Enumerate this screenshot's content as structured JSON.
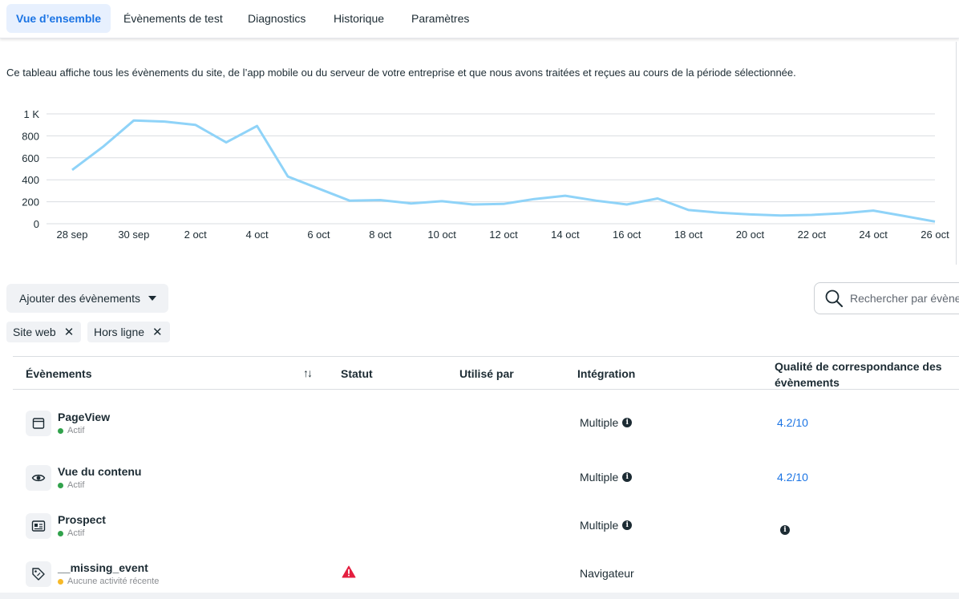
{
  "tabs": [
    {
      "label": "Vue d’ensemble",
      "active": true
    },
    {
      "label": "Évènements de test"
    },
    {
      "label": "Diagnostics"
    },
    {
      "label": "Historique"
    },
    {
      "label": "Paramètres"
    }
  ],
  "description": "Ce tableau affiche tous les évènements du site, de l’app mobile ou du serveur de votre entreprise et que nous avons traitées et reçues au cours de la période sélectionnée.",
  "chart_data": {
    "type": "line",
    "y_tick_labels": [
      "0",
      "200",
      "400",
      "600",
      "800",
      "1 K"
    ],
    "y_ticks": [
      0,
      200,
      400,
      600,
      800,
      1000
    ],
    "ylim": [
      0,
      1000
    ],
    "x_tick_labels": [
      "28 sep",
      "30 sep",
      "2 oct",
      "4 oct",
      "6 oct",
      "8 oct",
      "10 oct",
      "12 oct",
      "14 oct",
      "16 oct",
      "18 oct",
      "20 oct",
      "22 oct",
      "24 oct",
      "26 oct"
    ],
    "x": [
      "28 sep",
      "29 sep",
      "30 sep",
      "1 oct",
      "2 oct",
      "3 oct",
      "4 oct",
      "5 oct",
      "6 oct",
      "7 oct",
      "8 oct",
      "9 oct",
      "10 oct",
      "11 oct",
      "12 oct",
      "13 oct",
      "14 oct",
      "15 oct",
      "16 oct",
      "17 oct",
      "18 oct",
      "19 oct",
      "20 oct",
      "21 oct",
      "22 oct",
      "23 oct",
      "24 oct",
      "25 oct",
      "26 oct"
    ],
    "series": [
      {
        "color": "#8fd3f8",
        "values": [
          490,
          700,
          940,
          930,
          900,
          740,
          890,
          430,
          320,
          210,
          215,
          185,
          205,
          175,
          180,
          225,
          255,
          210,
          175,
          230,
          125,
          100,
          85,
          75,
          80,
          95,
          120,
          70,
          20
        ]
      }
    ],
    "grid": true
  },
  "controls": {
    "add_events_label": "Ajouter des évènements",
    "search_placeholder": "Rechercher par évènement",
    "filters": [
      "Site web",
      "Hors ligne"
    ]
  },
  "table": {
    "headers": {
      "events": "Évènements",
      "status": "Statut",
      "used_by": "Utilisé par",
      "integration": "Intégration",
      "quality_line1": "Qualité de correspondance des",
      "quality_line2": "évènements"
    },
    "rows": [
      {
        "icon": "browser-window-icon",
        "name": "PageView",
        "status": "Actif",
        "integration": "Multiple",
        "quality": "4.2/10"
      },
      {
        "icon": "eye-icon",
        "name": "Vue du contenu",
        "status": "Actif",
        "integration": "Multiple",
        "quality": "4.2/10"
      },
      {
        "icon": "id-card-icon",
        "name": "Prospect",
        "status": "Actif",
        "integration": "Multiple",
        "quality": ""
      },
      {
        "icon": "tag-icon",
        "name": "__missing_event",
        "status": "Aucune activité récente",
        "integration": "Navigateur",
        "quality": ""
      }
    ]
  },
  "colors": {
    "accent": "#1b74e4",
    "line": "#8fd3f8",
    "active_dot": "#31a24c",
    "warning": "#e41e3f"
  }
}
